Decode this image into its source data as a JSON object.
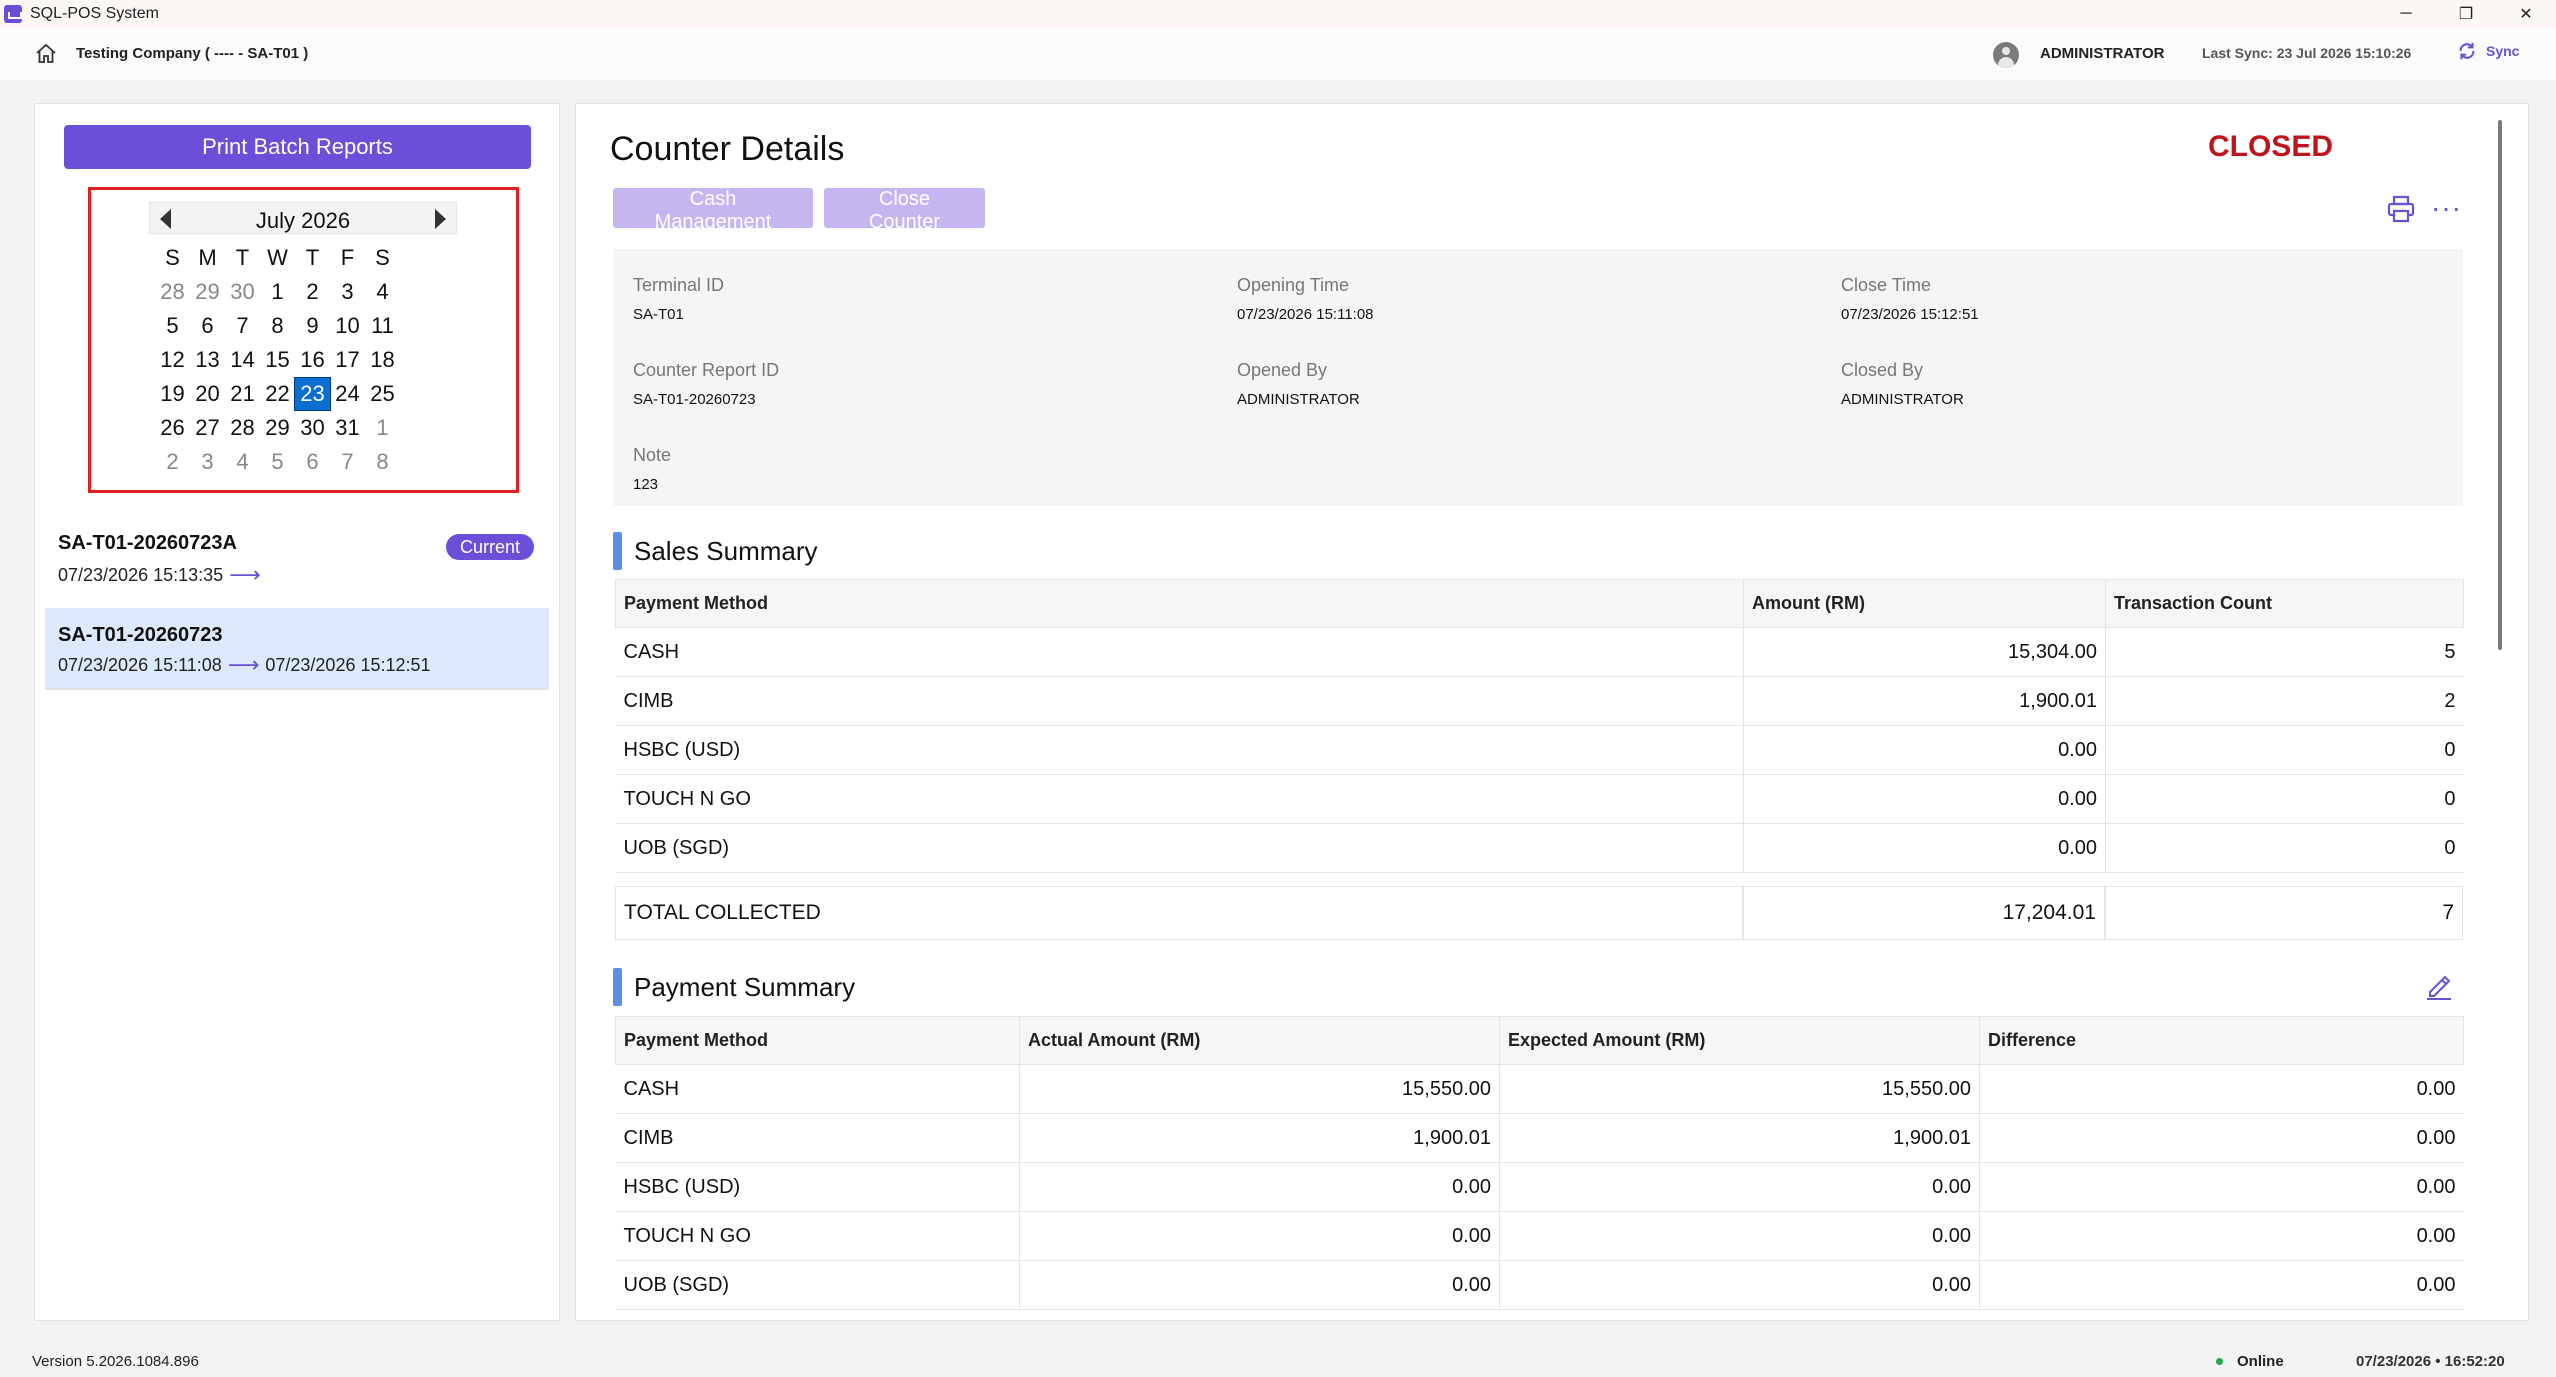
{
  "window": {
    "title": "SQL-POS System",
    "minimize": "─",
    "maximize": "❐",
    "close": "✕"
  },
  "header": {
    "company": "Testing Company ( ---- - SA-T01 )",
    "user": "ADMINISTRATOR",
    "last_sync": "Last Sync: 23 Jul 2026 15:10:26",
    "sync_label": "Sync"
  },
  "sidebar": {
    "print_batch_label": "Print Batch Reports",
    "calendar": {
      "month": "July 2026",
      "weekdays": [
        "S",
        "M",
        "T",
        "W",
        "T",
        "F",
        "S"
      ],
      "weeks": [
        [
          "28",
          "29",
          "30",
          "1",
          "2",
          "3",
          "4"
        ],
        [
          "5",
          "6",
          "7",
          "8",
          "9",
          "10",
          "11"
        ],
        [
          "12",
          "13",
          "14",
          "15",
          "16",
          "17",
          "18"
        ],
        [
          "19",
          "20",
          "21",
          "22",
          "23",
          "24",
          "25"
        ],
        [
          "26",
          "27",
          "28",
          "29",
          "30",
          "31",
          "1"
        ],
        [
          "2",
          "3",
          "4",
          "5",
          "6",
          "7",
          "8"
        ]
      ],
      "selected": "23"
    },
    "counters": [
      {
        "id": "SA-T01-20260723A",
        "open": "07/23/2026 15:13:35",
        "arrow": "⟶",
        "close": "",
        "badge": "Current"
      },
      {
        "id": "SA-T01-20260723",
        "open": "07/23/2026 15:11:08",
        "arrow": "⟶",
        "close": "07/23/2026 15:12:51",
        "badge": ""
      }
    ]
  },
  "main": {
    "title": "Counter Details",
    "status": "CLOSED",
    "cash_mgmt_label": "Cash Management",
    "close_counter_label": "Close Counter",
    "more_label": "···",
    "info": {
      "terminal_id_label": "Terminal ID",
      "terminal_id": "SA-T01",
      "opening_time_label": "Opening Time",
      "opening_time": "07/23/2026 15:11:08",
      "close_time_label": "Close Time",
      "close_time": "07/23/2026 15:12:51",
      "report_id_label": "Counter Report ID",
      "report_id": "SA-T01-20260723",
      "opened_by_label": "Opened By",
      "opened_by": "ADMINISTRATOR",
      "closed_by_label": "Closed By",
      "closed_by": "ADMINISTRATOR",
      "note_label": "Note",
      "note": "123"
    },
    "sales_summary": {
      "title": "Sales Summary",
      "headers": [
        "Payment Method",
        "Amount (RM)",
        "Transaction Count"
      ],
      "rows": [
        [
          "CASH",
          "15,304.00",
          "5"
        ],
        [
          "CIMB",
          "1,900.01",
          "2"
        ],
        [
          "HSBC (USD)",
          "0.00",
          "0"
        ],
        [
          "TOUCH N GO",
          "0.00",
          "0"
        ],
        [
          "UOB (SGD)",
          "0.00",
          "0"
        ]
      ],
      "total": [
        "TOTAL COLLECTED",
        "17,204.01",
        "7"
      ]
    },
    "payment_summary": {
      "title": "Payment Summary",
      "headers": [
        "Payment Method",
        "Actual Amount (RM)",
        "Expected Amount (RM)",
        "Difference"
      ],
      "rows": [
        [
          "CASH",
          "15,550.00",
          "15,550.00",
          "0.00"
        ],
        [
          "CIMB",
          "1,900.01",
          "1,900.01",
          "0.00"
        ],
        [
          "HSBC (USD)",
          "0.00",
          "0.00",
          "0.00"
        ],
        [
          "TOUCH N GO",
          "0.00",
          "0.00",
          "0.00"
        ],
        [
          "UOB (SGD)",
          "0.00",
          "0.00",
          "0.00"
        ]
      ]
    }
  },
  "footer": {
    "version": "Version 5.2026.1084.896",
    "online": "Online",
    "datetime": "07/23/2026  •  16:52:20"
  },
  "colors": {
    "accent": "#6a4fd8",
    "closed": "#c0141c",
    "selected_day": "#0a6fd0",
    "section_bar": "#5b8fe8"
  }
}
